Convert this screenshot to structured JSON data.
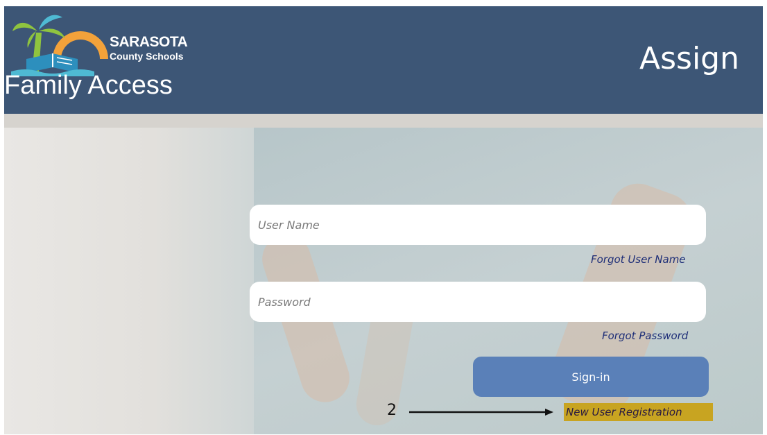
{
  "header": {
    "brand_name": "SARASOTA",
    "brand_sub": "County Schools",
    "app_title": "Family Access",
    "page_heading": "Assign"
  },
  "login": {
    "username_placeholder": "User Name",
    "username_value": "",
    "forgot_username": "Forgot User Name",
    "password_placeholder": "Password",
    "password_value": "",
    "forgot_password": "Forgot Password",
    "signin_label": "Sign-in",
    "new_user_registration": "New User Registration"
  },
  "annotation": {
    "step_number": "2"
  },
  "colors": {
    "header_bg": "#3d5676",
    "signin_bg": "#5a80b8",
    "link": "#1f2f78",
    "highlight": "#c8a421"
  },
  "icons": {
    "logo": "palm-tree-sun-book-logo"
  }
}
